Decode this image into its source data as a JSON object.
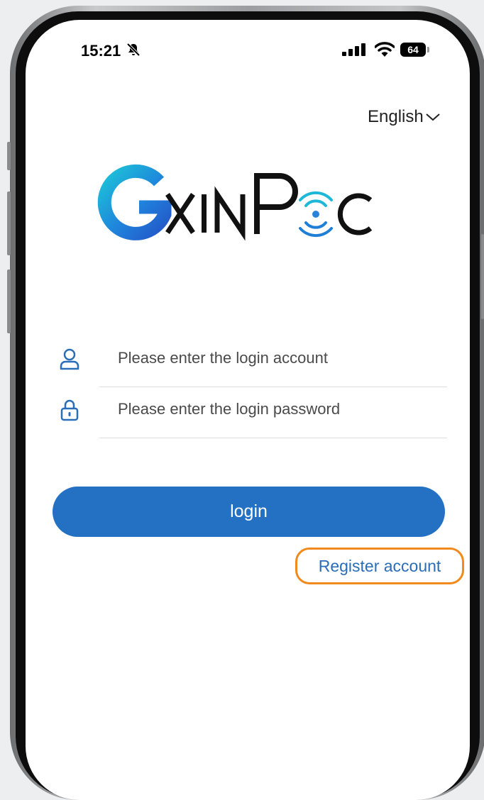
{
  "status_bar": {
    "time": "15:21",
    "battery": "64",
    "icons": [
      "bell-slash-icon",
      "signal-icon",
      "wifi-icon",
      "battery-icon"
    ]
  },
  "language": {
    "label": "English",
    "icon": "chevron-down-icon"
  },
  "logo": {
    "text": "GXINPOC"
  },
  "form": {
    "account_placeholder": "Please enter the login account",
    "password_placeholder": "Please enter the login password",
    "account_icon": "user-icon",
    "password_icon": "lock-icon"
  },
  "login_button": "login",
  "register_link": "Register account",
  "colors": {
    "primary": "#2471c4",
    "highlight": "#f08a1c",
    "link": "#2a6db8",
    "logo_blue": "#1f7fd6"
  }
}
